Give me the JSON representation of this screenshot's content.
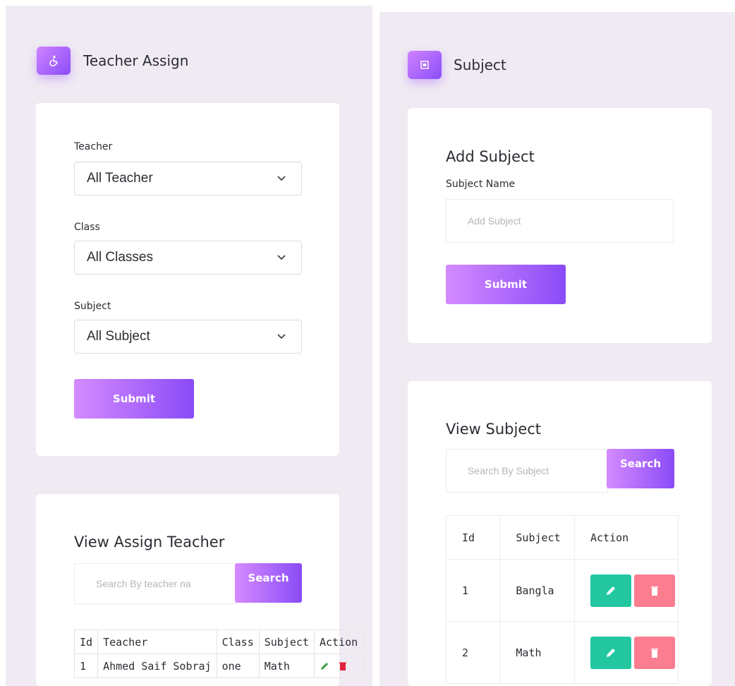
{
  "teacher_assign": {
    "title": "Teacher Assign",
    "form": {
      "teacher_label": "Teacher",
      "teacher_value": "All Teacher",
      "class_label": "Class",
      "class_value": "All Classes",
      "subject_label": "Subject",
      "subject_value": "All Subject",
      "submit_label": "Submit"
    },
    "view": {
      "title": "View Assign Teacher",
      "search_placeholder": "Search By  teacher na",
      "search_button": "Search",
      "headers": [
        "Id",
        "Teacher",
        "Class",
        "Subject",
        "Action"
      ],
      "rows": [
        {
          "id": "1",
          "teacher": "Ahmed Saif Sobraj",
          "class": "one",
          "subject": "Math"
        }
      ]
    }
  },
  "subject": {
    "title": "Subject",
    "add": {
      "title": "Add Subject",
      "name_label": "Subject Name",
      "name_placeholder": "Add Subject",
      "submit_label": "Submit"
    },
    "view": {
      "title": "View Subject",
      "search_placeholder": "Search By Subject",
      "search_button": "Search",
      "headers": [
        "Id",
        "Subject",
        "Action"
      ],
      "rows": [
        {
          "id": "1",
          "subject": "Bangla"
        },
        {
          "id": "2",
          "subject": "Math"
        }
      ]
    }
  },
  "colors": {
    "accent_start": "#d58bff",
    "accent_end": "#8a4bf7",
    "edit": "#22c7a0",
    "delete": "#fb7d90",
    "panel_bg": "#f0ebf2"
  },
  "icons": {
    "teacher_assign_header": "wheelchair-icon",
    "subject_header": "calendar-icon",
    "edit": "pencil-icon",
    "delete": "trash-icon",
    "dropdown": "chevron-down-icon"
  }
}
